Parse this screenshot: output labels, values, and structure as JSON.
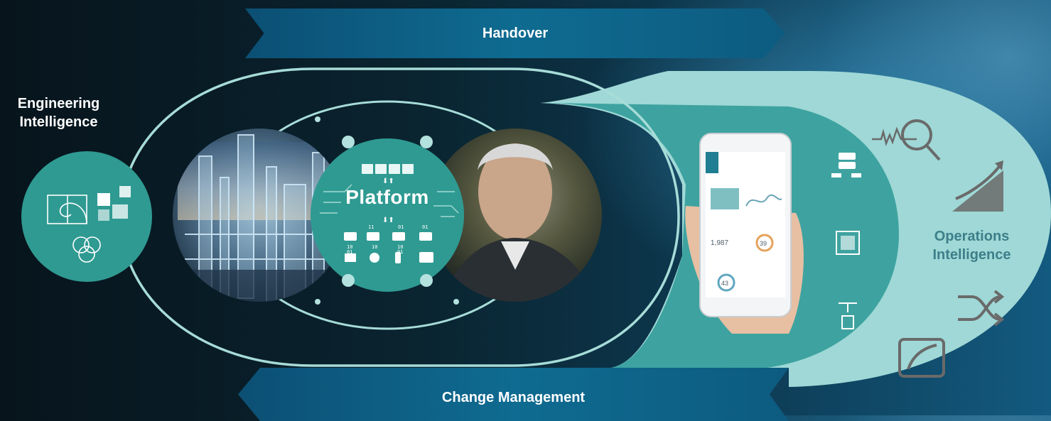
{
  "banners": {
    "top": "Handover",
    "bottom": "Change Management"
  },
  "labels": {
    "engineering": "Engineering Intelligence",
    "operations": "Operations Intelligence",
    "platform": "Platform"
  },
  "colors": {
    "background_dark": "#07141c",
    "banner_blue": "#0f6b91",
    "teal_circle": "#2f9a92",
    "light_teal": "#9fd8d6",
    "outline": "#a7dcd8",
    "ops_text": "#3d7f8a"
  },
  "icons": {
    "engineering": [
      "fibonacci-spiral-icon",
      "puzzle-pieces-icon",
      "venn-circles-icon"
    ],
    "platform_top": [
      "module-icon",
      "module-icon",
      "module-icon",
      "module-icon"
    ],
    "platform_bottom": [
      "binary-node-icon",
      "binary-node-icon",
      "binary-node-icon",
      "binary-node-icon",
      "factory-icon",
      "gear-icon",
      "bottle-icon",
      "device-icon"
    ],
    "right_panel": [
      "server-scale-icon",
      "chip-icon",
      "3d-printer-icon"
    ],
    "operations": [
      "magnifier-chart-icon",
      "rising-chart-icon",
      "shuffle-icon",
      "gauge-square-icon"
    ]
  },
  "images": {
    "refinery": "refinery-photo",
    "man": "man-portrait-photo",
    "phone": "smartphone-dashboard-photo"
  },
  "phone_dashboard": {
    "values": [
      "1,987",
      "39",
      "43"
    ]
  }
}
